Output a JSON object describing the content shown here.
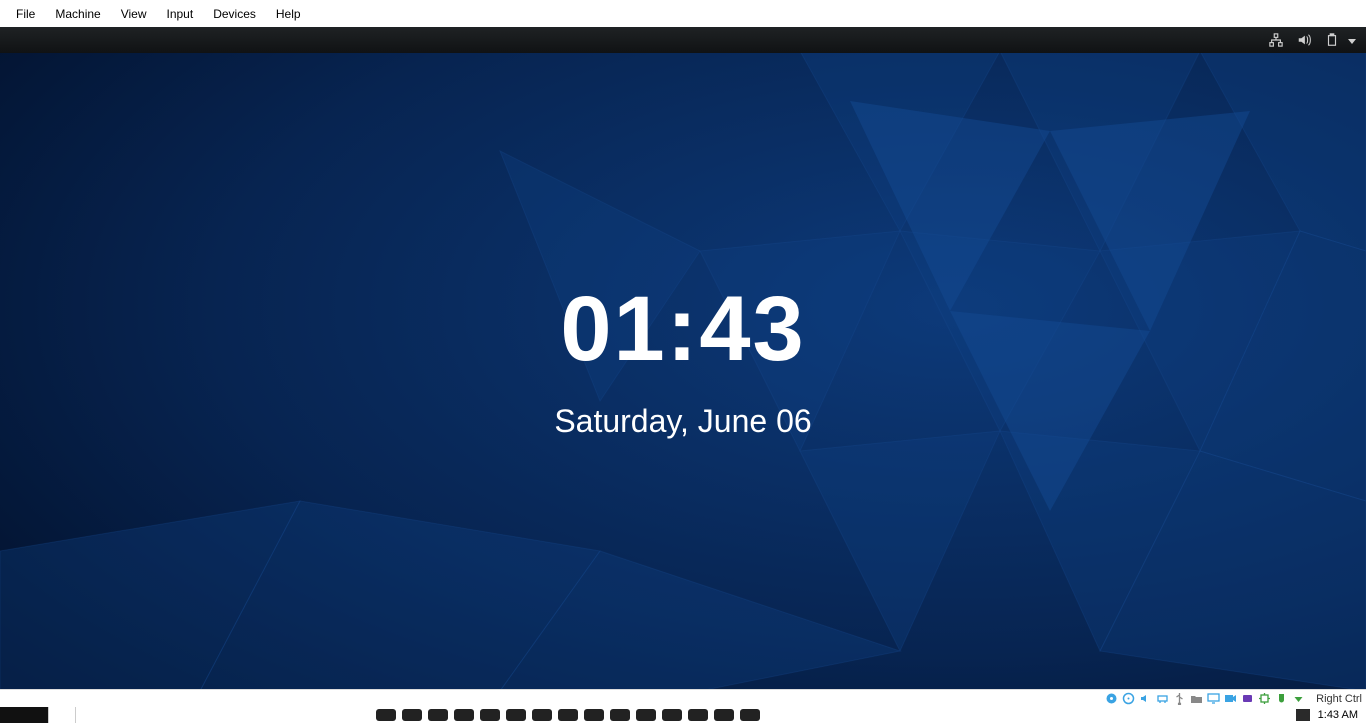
{
  "vm_menubar": {
    "items": [
      "File",
      "Machine",
      "View",
      "Input",
      "Devices",
      "Help"
    ]
  },
  "guest_topbar": {
    "icons": [
      "network-icon",
      "volume-icon",
      "battery-icon",
      "chevron-down-icon"
    ]
  },
  "lockscreen": {
    "time": "01:43",
    "date": "Saturday, June 06"
  },
  "vm_statusbar": {
    "indicators": [
      "hdd-icon",
      "cd-icon",
      "audio-icon",
      "net-icon",
      "usb-icon",
      "shared-folders-icon",
      "display-icon",
      "record-icon",
      "vrde-icon",
      "cpu-icon",
      "mouse-icon",
      "keyboard-icon"
    ],
    "hostkey_label": "Right Ctrl"
  },
  "host_taskbar": {
    "clock": "1:43 AM"
  }
}
